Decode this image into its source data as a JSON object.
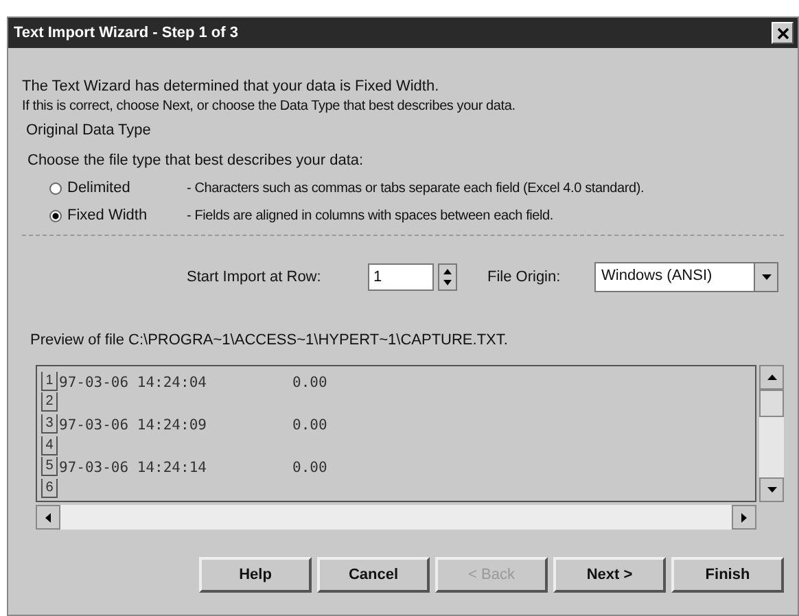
{
  "window": {
    "title": "Text Import Wizard - Step 1 of 3"
  },
  "intro": [
    "The Text Wizard has determined that your data is Fixed Width.",
    "If this is correct, choose Next, or choose the Data Type that best describes your data."
  ],
  "group": {
    "label": "Original Data Type",
    "prompt": "Choose the file type that best describes your data:",
    "options": [
      {
        "label": "Delimited",
        "description": "- Characters such as commas or tabs separate each field (Excel 4.0 standard).",
        "selected": false
      },
      {
        "label": "Fixed Width",
        "description": "- Fields are aligned in columns with spaces between each field.",
        "selected": true
      }
    ]
  },
  "start_row": {
    "label": "Start Import at Row:",
    "value": "1"
  },
  "file_origin": {
    "label": "File Origin:",
    "value": "Windows (ANSI)"
  },
  "preview": {
    "label": "Preview of file C:\\PROGRA~1\\ACCESS~1\\HYPERT~1\\CAPTURE.TXT.",
    "rows": [
      {
        "number": "1",
        "timestamp": "97-03-06 14:24:04",
        "value": "0.00"
      },
      {
        "number": "2"
      },
      {
        "number": "3",
        "timestamp": "97-03-06 14:24:09",
        "value": "0.00"
      },
      {
        "number": "4"
      },
      {
        "number": "5",
        "timestamp": "97-03-06 14:24:14",
        "value": "0.00"
      },
      {
        "number": "6"
      }
    ]
  },
  "buttons": [
    {
      "label": "Help",
      "disabled": false
    },
    {
      "label": "Cancel",
      "disabled": false
    },
    {
      "label": "< Back",
      "disabled": true
    },
    {
      "label": "Next >",
      "disabled": false
    },
    {
      "label": "Finish",
      "disabled": false
    }
  ]
}
